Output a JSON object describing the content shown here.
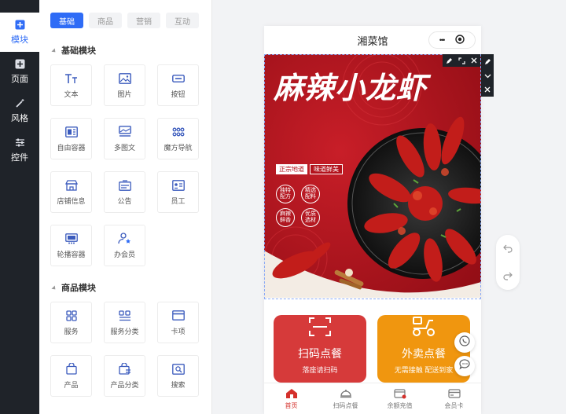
{
  "rail": {
    "items": [
      {
        "label": "模块",
        "icon": "plus-square-icon"
      },
      {
        "label": "页面",
        "icon": "page-plus-icon"
      },
      {
        "label": "风格",
        "icon": "magic-wand-icon"
      },
      {
        "label": "控件",
        "icon": "sliders-icon"
      }
    ]
  },
  "panel": {
    "tabs": [
      "基础",
      "商品",
      "营销",
      "互动"
    ],
    "basic_title": "基础模块",
    "basic_items": [
      {
        "label": "文本",
        "icon": "text-icon"
      },
      {
        "label": "图片",
        "icon": "image-icon"
      },
      {
        "label": "按钮",
        "icon": "button-icon"
      },
      {
        "label": "自由容器",
        "icon": "container-icon"
      },
      {
        "label": "多图文",
        "icon": "multi-image-text-icon"
      },
      {
        "label": "魔方导航",
        "icon": "grid-dots-icon"
      },
      {
        "label": "店铺信息",
        "icon": "store-icon"
      },
      {
        "label": "公告",
        "icon": "notice-icon"
      },
      {
        "label": "员工",
        "icon": "id-card-icon"
      },
      {
        "label": "轮播容器",
        "icon": "carousel-icon"
      },
      {
        "label": "办会员",
        "icon": "member-icon"
      }
    ],
    "goods_title": "商品模块",
    "goods_items": [
      {
        "label": "服务",
        "icon": "service-grid-icon"
      },
      {
        "label": "服务分类",
        "icon": "service-category-icon"
      },
      {
        "label": "卡项",
        "icon": "card-icon"
      },
      {
        "label": "产品",
        "icon": "bag-icon"
      },
      {
        "label": "产品分类",
        "icon": "bag-category-icon"
      },
      {
        "label": "搜索",
        "icon": "search-icon"
      }
    ]
  },
  "phone": {
    "title": "湘菜馆",
    "capsule_more": "•••",
    "banner": {
      "headline": "麻辣小龙虾",
      "tag1": "正宗地道",
      "tag2": "味道鲜美",
      "badges": [
        "独特配方",
        "精选配料",
        "麻辣鲜香",
        "优质选材"
      ]
    },
    "buttons": [
      {
        "title": "扫码点餐",
        "subtitle": "落座请扫码",
        "color": "#d63a3a",
        "icon": "scan-icon"
      },
      {
        "title": "外卖点餐",
        "subtitle": "无需接触  配送到家",
        "color": "#f0960f",
        "icon": "scooter-icon"
      }
    ],
    "tabbar": [
      {
        "label": "首页",
        "icon": "home-icon",
        "active": true
      },
      {
        "label": "扫码点餐",
        "icon": "dish-cover-icon",
        "active": false
      },
      {
        "label": "余额充值",
        "icon": "recharge-icon",
        "active": false
      },
      {
        "label": "会员卡",
        "icon": "member-card-icon",
        "active": false
      }
    ]
  },
  "colors": {
    "accent": "#2f6cf6",
    "rail_bg": "#1f2329",
    "banner_red": "#b3121c",
    "active_tab": "#d4302b"
  }
}
